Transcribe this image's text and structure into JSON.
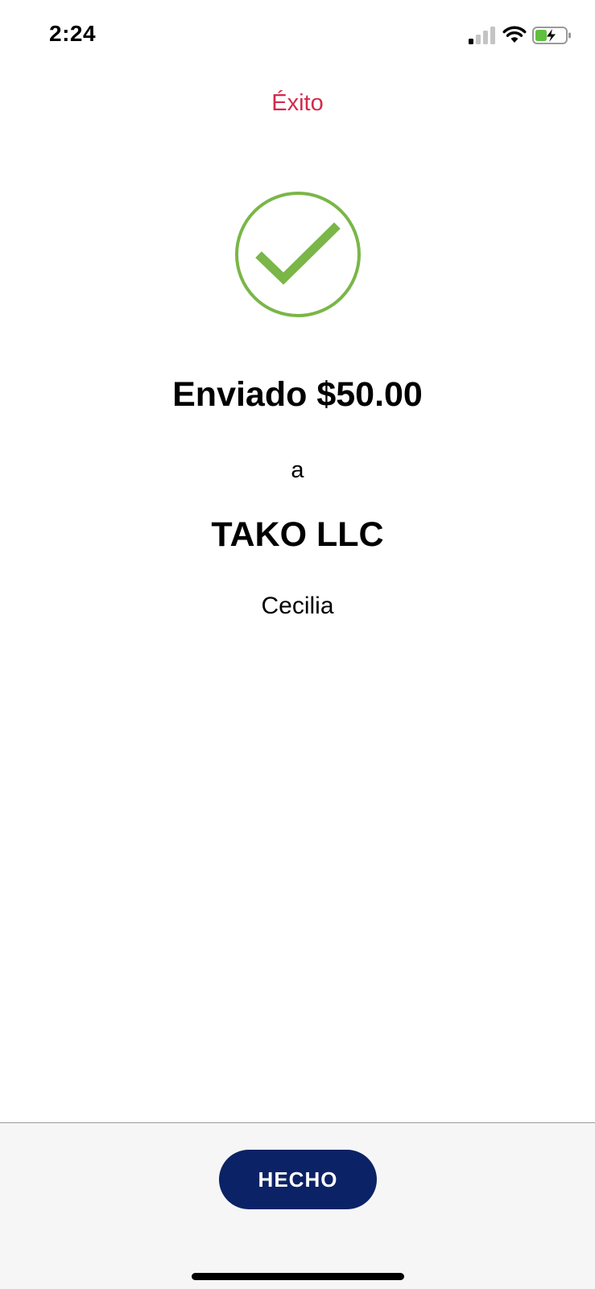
{
  "status_bar": {
    "time": "2:24",
    "icons": [
      "signal-icon",
      "wifi-icon",
      "battery-charging-icon"
    ]
  },
  "header": {
    "title": "Éxito",
    "title_color": "#d42a4c"
  },
  "result": {
    "icon": "check-circle-icon",
    "icon_color": "#7ab648",
    "amount_text": "Enviado $50.00",
    "to_label": "a",
    "recipient": "TAKO LLC",
    "recipient_sub": "Cecilia"
  },
  "footer": {
    "done_label": "HECHO",
    "button_color": "#0b2266"
  }
}
